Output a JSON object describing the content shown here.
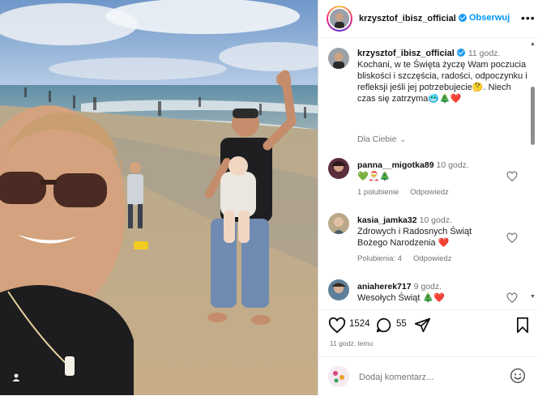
{
  "post": {
    "author": "krzysztof_ibisz_official",
    "follow_label": "Obserwuj",
    "more_label": "•••",
    "caption_time": "11 godz.",
    "caption_text": "Kochani, w te Święta życzę Wam poczucia bliskości i szczęścia, radości, odpoczynku i refleksji jeśli jej potrzebujecie🤔. Niech czas się zatrzyma🥶🎄❤️",
    "for_you_label": "Dla Ciebie"
  },
  "comments": [
    {
      "user": "panna__migotka89",
      "time": "10 godz.",
      "text": "💚🎅🎄",
      "likes": "1 polubienie",
      "reply": "Odpowiedz"
    },
    {
      "user": "kasia_jamka32",
      "time": "10 godz.",
      "text": "Zdrowych i Radosnych Świąt Bożego Narodzenia ❤️",
      "likes": "Polubienia: 4",
      "reply": "Odpowiedz"
    },
    {
      "user": "aniaherek717",
      "time": "9 godz.",
      "text": "Wesołych Świąt 🎄❤️",
      "likes": "",
      "reply": ""
    }
  ],
  "stats": {
    "likes_count": "1524",
    "comments_count": "55"
  },
  "time_ago": "11 godz. temu",
  "add_comment": {
    "placeholder": "Dodaj komentarz..."
  },
  "colors": {
    "accent": "#0095f6",
    "verified": "#1d9bf0",
    "muted": "#737373"
  },
  "icons": [
    "heart-icon",
    "comment-icon",
    "share-icon",
    "bookmark-icon",
    "emoji-icon",
    "more-icon",
    "user-tag-icon"
  ]
}
